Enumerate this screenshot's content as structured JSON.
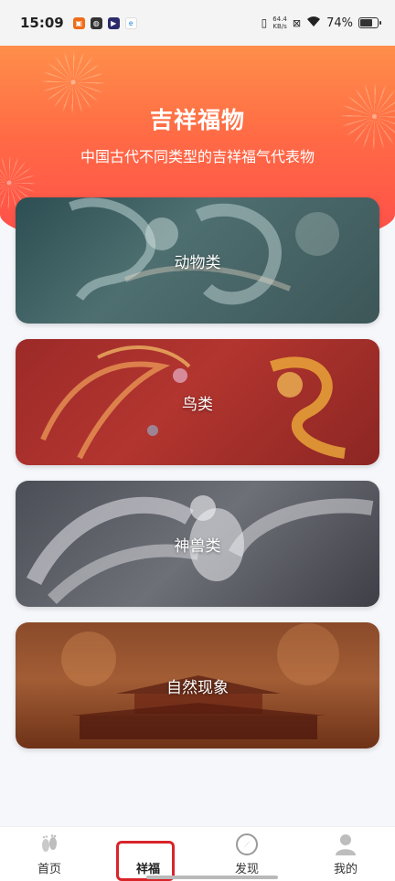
{
  "status_bar": {
    "time": "15:09",
    "net_speed_value": "64.4",
    "net_speed_unit": "KB/s",
    "battery": "74%",
    "battery_level": 0.74
  },
  "header": {
    "title": "吉祥福物",
    "subtitle": "中国古代不同类型的吉祥福气代表物"
  },
  "categories": [
    {
      "label": "动物类"
    },
    {
      "label": "鸟类"
    },
    {
      "label": "神兽类"
    },
    {
      "label": "自然现象"
    }
  ],
  "tabbar": {
    "items": [
      {
        "label": "首页",
        "icon": "footprints-icon"
      },
      {
        "label": "祥福",
        "icon": "none",
        "active": true
      },
      {
        "label": "发现",
        "icon": "compass-icon"
      },
      {
        "label": "我的",
        "icon": "user-icon"
      }
    ]
  },
  "colors": {
    "header_gradient_top": "#ff8f4a",
    "header_gradient_bottom": "#ff4b4b",
    "highlight": "#d9242a"
  }
}
